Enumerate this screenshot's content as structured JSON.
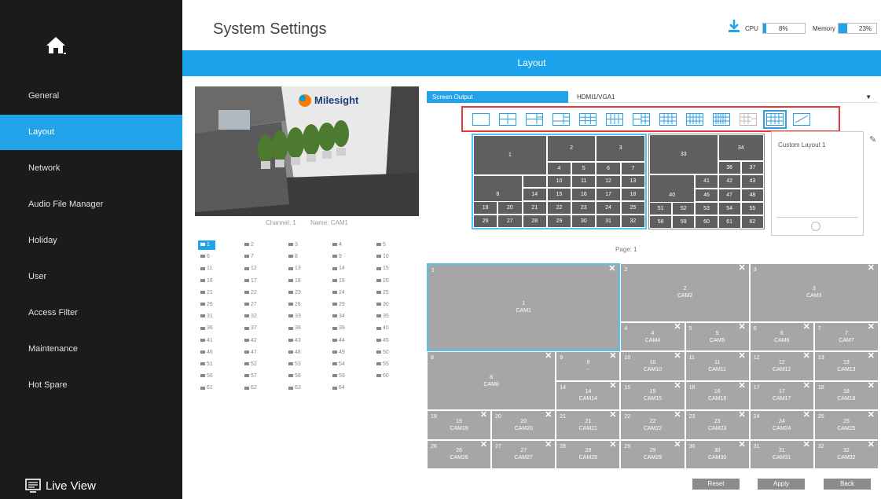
{
  "sidebar": {
    "items": [
      {
        "label": "General",
        "active": false
      },
      {
        "label": "Layout",
        "active": true
      },
      {
        "label": "Network",
        "active": false
      },
      {
        "label": "Audio File Manager",
        "active": false
      },
      {
        "label": "Holiday",
        "active": false
      },
      {
        "label": "User",
        "active": false
      },
      {
        "label": "Access Filter",
        "active": false
      },
      {
        "label": "Maintenance",
        "active": false
      },
      {
        "label": "Hot Spare",
        "active": false
      }
    ],
    "live_view_label": "Live View"
  },
  "header": {
    "title": "System Settings",
    "cpu_label": "CPU",
    "cpu_value": "8%",
    "cpu_percent": 8,
    "memory_label": "Memory",
    "memory_value": "23%",
    "memory_percent": 23
  },
  "section_title": "Layout",
  "preview": {
    "channel_text": "Channel: 1",
    "name_text": "Name: CAM1",
    "logo_text": "Milesight"
  },
  "channels": {
    "selected": 1,
    "labels": [
      "1",
      "2",
      "3",
      "4",
      "5",
      "6",
      "7",
      "8",
      "9",
      "10",
      "11",
      "12",
      "13",
      "14",
      "15",
      "16",
      "17",
      "18",
      "19",
      "20",
      "21",
      "22",
      "23",
      "24",
      "25",
      "26",
      "27",
      "28",
      "29",
      "30",
      "31",
      "32",
      "33",
      "34",
      "35",
      "36",
      "37",
      "38",
      "39",
      "40",
      "41",
      "42",
      "43",
      "44",
      "45",
      "46",
      "47",
      "48",
      "49",
      "50",
      "51",
      "52",
      "53",
      "54",
      "55",
      "56",
      "57",
      "58",
      "59",
      "60",
      "61",
      "62",
      "63",
      "64"
    ]
  },
  "screen_output": {
    "label": "Screen Output",
    "value": "HDMI1/VGA1"
  },
  "layout_modes": {
    "selected_index": 12,
    "names": [
      "layout-1",
      "layout-4",
      "layout-6",
      "layout-8",
      "layout-9",
      "layout-12",
      "layout-14",
      "layout-16",
      "layout-25",
      "layout-32",
      "layout-64",
      "layout-32-selected",
      "layout-custom"
    ]
  },
  "custom_layout": {
    "title": "Custom Layout 1"
  },
  "page_indicator": "Page: 1",
  "grid_cells": [
    {
      "num": "1",
      "name": "CAM1",
      "sel": true
    },
    {
      "num": "2",
      "name": "CAM2"
    },
    {
      "num": "3",
      "name": "CAM3"
    },
    {
      "num": "4",
      "name": "CAM4"
    },
    {
      "num": "5",
      "name": "CAM5"
    },
    {
      "num": "6",
      "name": "CAM6"
    },
    {
      "num": "7",
      "name": "CAM7"
    },
    {
      "num": "8",
      "name": "CAM8"
    },
    {
      "num": "9",
      "name": "-"
    },
    {
      "num": "10",
      "name": "CAM10"
    },
    {
      "num": "11",
      "name": "CAM11"
    },
    {
      "num": "12",
      "name": "CAM12"
    },
    {
      "num": "13",
      "name": "CAM13"
    },
    {
      "num": "14",
      "name": "CAM14"
    },
    {
      "num": "15",
      "name": "CAM15"
    },
    {
      "num": "16",
      "name": "CAM16"
    },
    {
      "num": "17",
      "name": "CAM17"
    },
    {
      "num": "18",
      "name": "CAM18"
    },
    {
      "num": "19",
      "name": "CAM19"
    },
    {
      "num": "20",
      "name": "CAM20"
    },
    {
      "num": "21",
      "name": "CAM21"
    },
    {
      "num": "22",
      "name": "CAM22"
    },
    {
      "num": "23",
      "name": "CAM23"
    },
    {
      "num": "24",
      "name": "CAM24"
    },
    {
      "num": "25",
      "name": "CAM25"
    },
    {
      "num": "26",
      "name": "CAM26"
    },
    {
      "num": "27",
      "name": "CAM27"
    },
    {
      "num": "28",
      "name": "CAM28"
    },
    {
      "num": "29",
      "name": "CAM29"
    },
    {
      "num": "30",
      "name": "CAM30"
    },
    {
      "num": "31",
      "name": "CAM31"
    },
    {
      "num": "32",
      "name": "CAM32"
    }
  ],
  "template_a": {
    "labels": [
      "1",
      "2",
      "3",
      "4",
      "5",
      "6",
      "7",
      "8",
      "10",
      "11",
      "12",
      "13",
      "14",
      "15",
      "16",
      "17",
      "18",
      "19",
      "20",
      "21",
      "22",
      "23",
      "24",
      "25",
      "26",
      "27",
      "28",
      "29",
      "30",
      "31",
      "32"
    ]
  },
  "template_b": {
    "labels": [
      "33",
      "34",
      "36",
      "37",
      "40",
      "41",
      "42",
      "43",
      "46",
      "47",
      "48",
      "51",
      "52",
      "53",
      "54",
      "55",
      "58",
      "59",
      "60",
      "61",
      "62"
    ]
  },
  "buttons": {
    "reset": "Reset",
    "apply": "Apply",
    "back": "Back"
  },
  "colors": {
    "accent": "#20a3e8",
    "sidebar_bg": "#1b1b1b",
    "cell_bg": "#a6a6a6",
    "template_bg": "#5f5f5f",
    "highlight_border": "#e53935"
  }
}
